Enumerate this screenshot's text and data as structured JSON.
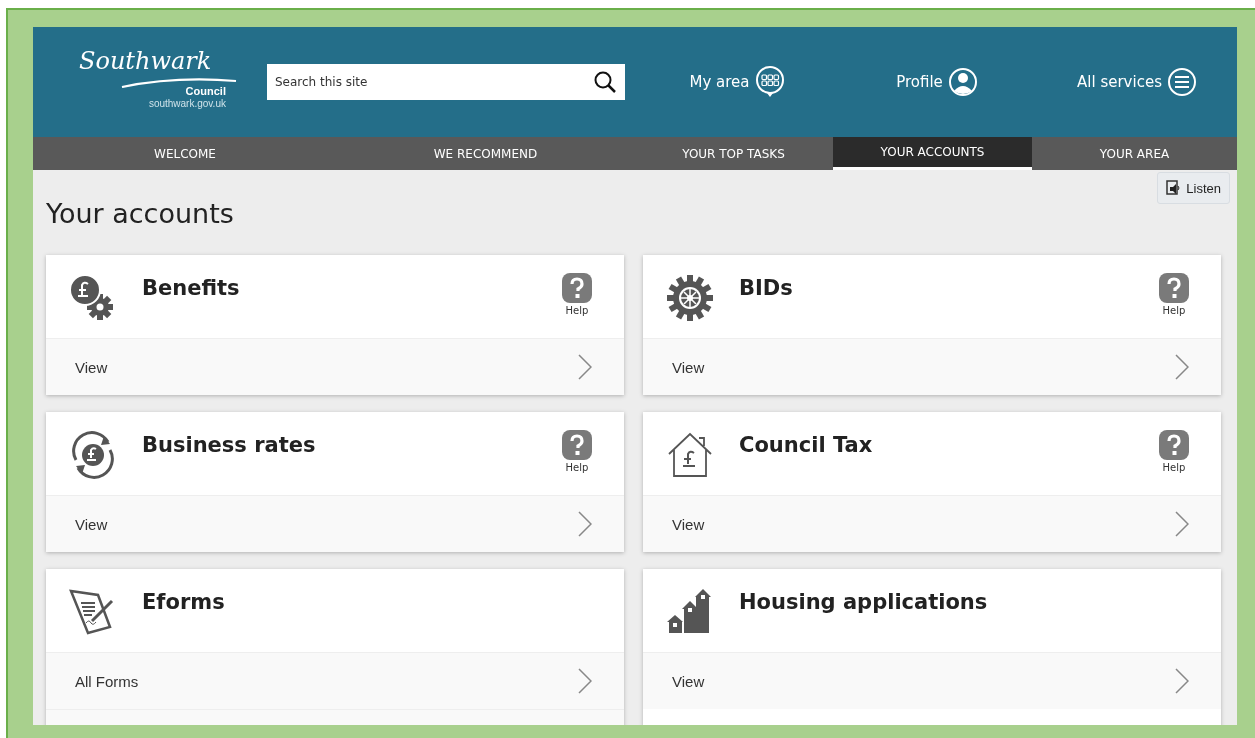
{
  "logo": {
    "script": "Southwark",
    "name": "Council",
    "url": "southwark.gov.uk"
  },
  "search": {
    "placeholder": "Search this site"
  },
  "header_links": [
    {
      "label": "My area",
      "kind": "area"
    },
    {
      "label": "Profile",
      "kind": "profile"
    },
    {
      "label": "All services",
      "kind": "menu"
    }
  ],
  "tabs": [
    {
      "label": "WELCOME",
      "selected": false
    },
    {
      "label": "WE RECOMMEND",
      "selected": false
    },
    {
      "label": "YOUR TOP TASKS",
      "selected": false
    },
    {
      "label": "YOUR ACCOUNTS",
      "selected": true
    },
    {
      "label": "YOUR AREA",
      "selected": false
    }
  ],
  "listen": "Listen",
  "title": "Your accounts",
  "cards": [
    {
      "title": "Benefits",
      "kind": "benefits",
      "help": "Help",
      "links": [
        "View"
      ],
      "empty_row": false
    },
    {
      "title": "BIDs",
      "kind": "gear",
      "help": "Help",
      "links": [
        "View"
      ],
      "empty_row": false
    },
    {
      "title": "Business rates",
      "kind": "rates",
      "help": "Help",
      "links": [
        "View"
      ],
      "empty_row": false
    },
    {
      "title": "Council Tax",
      "kind": "house",
      "help": "Help",
      "links": [
        "View"
      ],
      "empty_row": false
    },
    {
      "title": "Eforms",
      "kind": "form",
      "links": [
        "All Forms"
      ],
      "empty_row": true
    },
    {
      "title": "Housing applications",
      "kind": "housing",
      "links": [
        "View"
      ],
      "empty_row": false
    }
  ]
}
